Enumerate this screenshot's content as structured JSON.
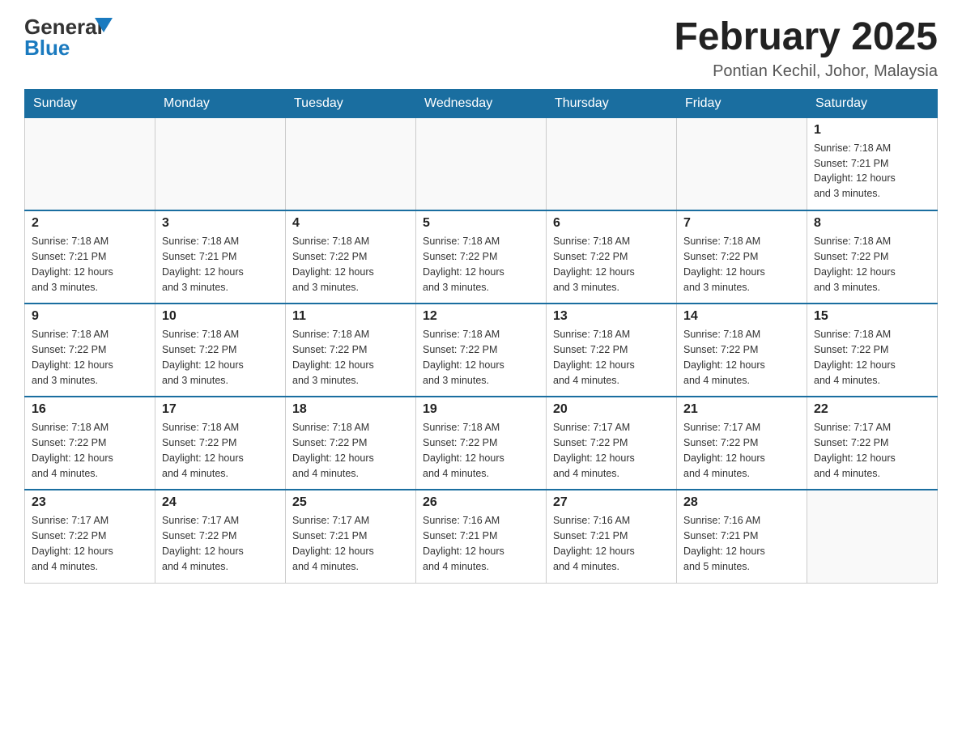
{
  "header": {
    "logo_general": "General",
    "logo_blue": "Blue",
    "title": "February 2025",
    "subtitle": "Pontian Kechil, Johor, Malaysia"
  },
  "days_of_week": [
    "Sunday",
    "Monday",
    "Tuesday",
    "Wednesday",
    "Thursday",
    "Friday",
    "Saturday"
  ],
  "weeks": [
    [
      {
        "day": "",
        "info": ""
      },
      {
        "day": "",
        "info": ""
      },
      {
        "day": "",
        "info": ""
      },
      {
        "day": "",
        "info": ""
      },
      {
        "day": "",
        "info": ""
      },
      {
        "day": "",
        "info": ""
      },
      {
        "day": "1",
        "info": "Sunrise: 7:18 AM\nSunset: 7:21 PM\nDaylight: 12 hours\nand 3 minutes."
      }
    ],
    [
      {
        "day": "2",
        "info": "Sunrise: 7:18 AM\nSunset: 7:21 PM\nDaylight: 12 hours\nand 3 minutes."
      },
      {
        "day": "3",
        "info": "Sunrise: 7:18 AM\nSunset: 7:21 PM\nDaylight: 12 hours\nand 3 minutes."
      },
      {
        "day": "4",
        "info": "Sunrise: 7:18 AM\nSunset: 7:22 PM\nDaylight: 12 hours\nand 3 minutes."
      },
      {
        "day": "5",
        "info": "Sunrise: 7:18 AM\nSunset: 7:22 PM\nDaylight: 12 hours\nand 3 minutes."
      },
      {
        "day": "6",
        "info": "Sunrise: 7:18 AM\nSunset: 7:22 PM\nDaylight: 12 hours\nand 3 minutes."
      },
      {
        "day": "7",
        "info": "Sunrise: 7:18 AM\nSunset: 7:22 PM\nDaylight: 12 hours\nand 3 minutes."
      },
      {
        "day": "8",
        "info": "Sunrise: 7:18 AM\nSunset: 7:22 PM\nDaylight: 12 hours\nand 3 minutes."
      }
    ],
    [
      {
        "day": "9",
        "info": "Sunrise: 7:18 AM\nSunset: 7:22 PM\nDaylight: 12 hours\nand 3 minutes."
      },
      {
        "day": "10",
        "info": "Sunrise: 7:18 AM\nSunset: 7:22 PM\nDaylight: 12 hours\nand 3 minutes."
      },
      {
        "day": "11",
        "info": "Sunrise: 7:18 AM\nSunset: 7:22 PM\nDaylight: 12 hours\nand 3 minutes."
      },
      {
        "day": "12",
        "info": "Sunrise: 7:18 AM\nSunset: 7:22 PM\nDaylight: 12 hours\nand 3 minutes."
      },
      {
        "day": "13",
        "info": "Sunrise: 7:18 AM\nSunset: 7:22 PM\nDaylight: 12 hours\nand 4 minutes."
      },
      {
        "day": "14",
        "info": "Sunrise: 7:18 AM\nSunset: 7:22 PM\nDaylight: 12 hours\nand 4 minutes."
      },
      {
        "day": "15",
        "info": "Sunrise: 7:18 AM\nSunset: 7:22 PM\nDaylight: 12 hours\nand 4 minutes."
      }
    ],
    [
      {
        "day": "16",
        "info": "Sunrise: 7:18 AM\nSunset: 7:22 PM\nDaylight: 12 hours\nand 4 minutes."
      },
      {
        "day": "17",
        "info": "Sunrise: 7:18 AM\nSunset: 7:22 PM\nDaylight: 12 hours\nand 4 minutes."
      },
      {
        "day": "18",
        "info": "Sunrise: 7:18 AM\nSunset: 7:22 PM\nDaylight: 12 hours\nand 4 minutes."
      },
      {
        "day": "19",
        "info": "Sunrise: 7:18 AM\nSunset: 7:22 PM\nDaylight: 12 hours\nand 4 minutes."
      },
      {
        "day": "20",
        "info": "Sunrise: 7:17 AM\nSunset: 7:22 PM\nDaylight: 12 hours\nand 4 minutes."
      },
      {
        "day": "21",
        "info": "Sunrise: 7:17 AM\nSunset: 7:22 PM\nDaylight: 12 hours\nand 4 minutes."
      },
      {
        "day": "22",
        "info": "Sunrise: 7:17 AM\nSunset: 7:22 PM\nDaylight: 12 hours\nand 4 minutes."
      }
    ],
    [
      {
        "day": "23",
        "info": "Sunrise: 7:17 AM\nSunset: 7:22 PM\nDaylight: 12 hours\nand 4 minutes."
      },
      {
        "day": "24",
        "info": "Sunrise: 7:17 AM\nSunset: 7:22 PM\nDaylight: 12 hours\nand 4 minutes."
      },
      {
        "day": "25",
        "info": "Sunrise: 7:17 AM\nSunset: 7:21 PM\nDaylight: 12 hours\nand 4 minutes."
      },
      {
        "day": "26",
        "info": "Sunrise: 7:16 AM\nSunset: 7:21 PM\nDaylight: 12 hours\nand 4 minutes."
      },
      {
        "day": "27",
        "info": "Sunrise: 7:16 AM\nSunset: 7:21 PM\nDaylight: 12 hours\nand 4 minutes."
      },
      {
        "day": "28",
        "info": "Sunrise: 7:16 AM\nSunset: 7:21 PM\nDaylight: 12 hours\nand 5 minutes."
      },
      {
        "day": "",
        "info": ""
      }
    ]
  ]
}
